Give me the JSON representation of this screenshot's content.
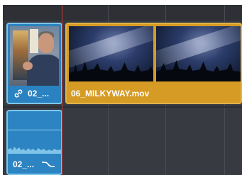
{
  "timeline": {
    "video_clips": [
      {
        "label": "02_...",
        "icon": "link-icon"
      },
      {
        "label": "06_MILKYWAY.mov"
      }
    ],
    "audio_clips": [
      {
        "label": "02_...",
        "icon": "fade-curve-icon"
      }
    ]
  },
  "colors": {
    "interview_clip": "#2b82c0",
    "milkyway_clip": "#d69b24",
    "playhead": "#c83a32",
    "background": "#383a41"
  }
}
